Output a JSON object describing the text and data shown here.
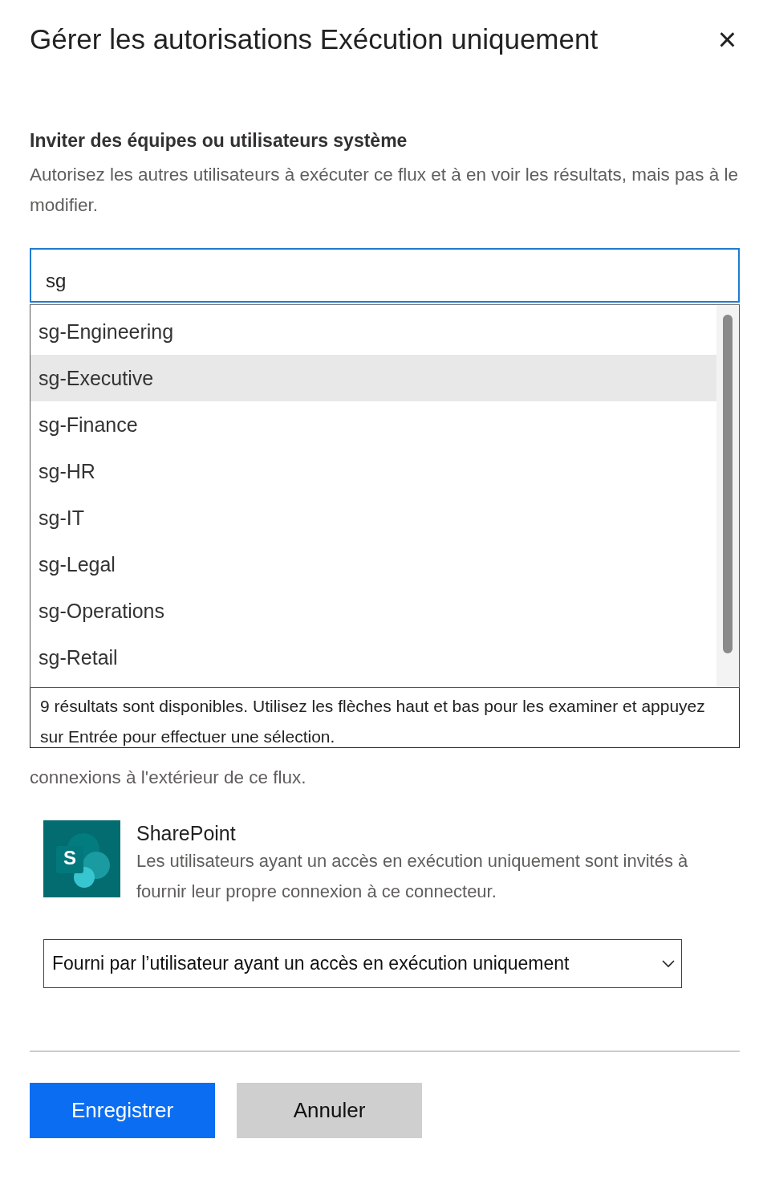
{
  "dialog": {
    "title": "Gérer les autorisations Exécution uniquement",
    "close": "×"
  },
  "invite": {
    "heading": "Inviter des équipes ou utilisateurs système",
    "description": "Autorisez les autres utilisateurs à exécuter ce flux et à en voir les résultats, mais pas à le modifier."
  },
  "search": {
    "value": "sg"
  },
  "suggestions": [
    {
      "label": "sg-Engineering",
      "selected": false
    },
    {
      "label": "sg-Executive",
      "selected": true
    },
    {
      "label": "sg-Finance",
      "selected": false
    },
    {
      "label": "sg-HR",
      "selected": false
    },
    {
      "label": "sg-IT",
      "selected": false
    },
    {
      "label": "sg-Legal",
      "selected": false
    },
    {
      "label": "sg-Operations",
      "selected": false
    },
    {
      "label": "sg-Retail",
      "selected": false
    }
  ],
  "results_hint": "9 résultats sont disponibles. Utilisez les flèches haut et bas pour les examiner et appuyez sur Entrée pour effectuer une sélection.",
  "connections_note": "connexions à l'extérieur de ce flux.",
  "connector": {
    "logo_letter": "S",
    "name": "SharePoint",
    "description": "Les utilisateurs ayant un accès en exécution uniquement sont invités à fournir leur propre connexion à ce connecteur."
  },
  "connection_select": {
    "value": "Fourni par l’utilisateur ayant un accès en exécution uniquement"
  },
  "buttons": [
    {
      "label": "Enregistrer",
      "kind": "primary"
    },
    {
      "label": "Annuler",
      "kind": "secondary"
    }
  ]
}
